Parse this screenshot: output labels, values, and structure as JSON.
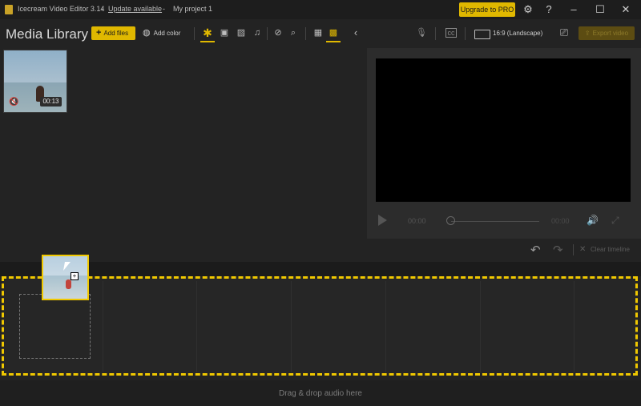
{
  "titlebar": {
    "app_name": "Icecream Video Editor 3.14",
    "separator": "-",
    "update_link": "Update available",
    "project_name": "My project 1",
    "upgrade_label": "Upgrade to PRO",
    "icons": [
      "settings-icon",
      "help-icon",
      "minimize-icon",
      "maximize-icon",
      "close-icon"
    ]
  },
  "library": {
    "title": "Media Library",
    "add_files": "Add files",
    "add_color": "Add color",
    "filter_icons": [
      "star-icon",
      "video-icon",
      "image-icon",
      "music-icon"
    ],
    "view_icons": [
      "zoom-icon",
      "search-icon",
      "grid-large-icon",
      "grid-small-icon",
      "collapse-icon"
    ],
    "items": [
      {
        "duration": "00:13",
        "muted": true
      }
    ]
  },
  "preview": {
    "aspect": "16:9 (Landscape)",
    "export_label": "Export video",
    "current_time": "00:00",
    "total_time": "00:00",
    "seek_fraction": 0
  },
  "timeline": {
    "clear_label": "Clear timeline",
    "audio_drop_label": "Drag & drop audio here"
  },
  "colors": {
    "accent": "#e0b800",
    "background": "#232323",
    "drop_border": "#f0c800"
  }
}
